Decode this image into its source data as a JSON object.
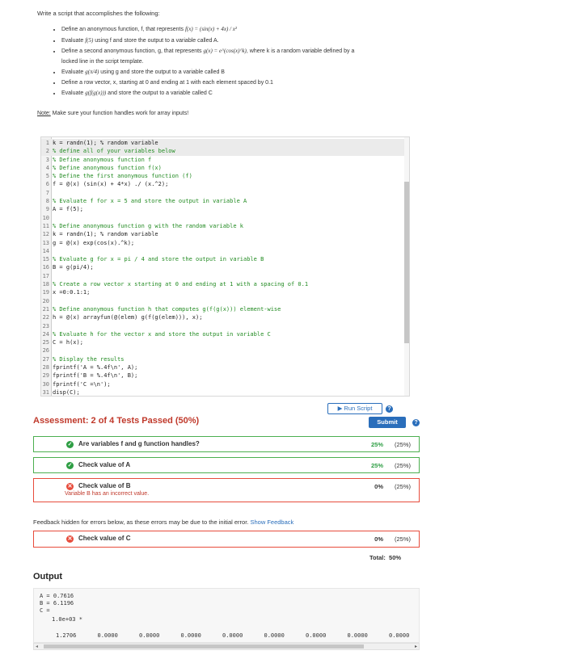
{
  "intro": "Write a script that accomplishes the following:",
  "tasks": [
    {
      "pre": "Define an anonymous function, f, that represents ",
      "math": "f(x) = (sin(x) + 4x) / x²",
      "post": ""
    },
    {
      "pre": "Evaluate ",
      "math": "f(5)",
      "post": " using f and store the output to a variable called A."
    },
    {
      "pre": "Define a second anonymous function, g, that represents ",
      "math": "g(x) = e^(cos(x)^k)",
      "post": ", where k is a random variable defined by a locked line in the script template."
    },
    {
      "pre": "Evaluate ",
      "math": "g(π/4)",
      "post": " using g and store the output to a variable called B"
    },
    {
      "pre": "Define a row vector, x, starting at 0 and ending at 1 with each element spaced by 0.1",
      "math": "",
      "post": ""
    },
    {
      "pre": "Evaluate ",
      "math": "g(f(g(x)))",
      "post": " and store the output to a variable called C"
    }
  ],
  "note_label": "Note:",
  "note_text": " Make sure your function handles work for array inputs!",
  "code": [
    {
      "n": "1",
      "t": "k = randn(1); % random variable",
      "c": false,
      "hl": true
    },
    {
      "n": "2",
      "t": "% define all of your variables below",
      "c": true,
      "hl": true
    },
    {
      "n": "3",
      "t": "% Define anonymous function f",
      "c": true,
      "hl": false
    },
    {
      "n": "4",
      "t": "% Define anonymous function f(x)",
      "c": true,
      "hl": false
    },
    {
      "n": "5",
      "t": "% Define the first anonymous function (f)",
      "c": true,
      "hl": false
    },
    {
      "n": "6",
      "t": "f = @(x) (sin(x) + 4*x) ./ (x.^2);",
      "c": false,
      "hl": false
    },
    {
      "n": "7",
      "t": "",
      "c": false,
      "hl": false
    },
    {
      "n": "8",
      "t": "% Evaluate f for x = 5 and store the output in variable A",
      "c": true,
      "hl": false
    },
    {
      "n": "9",
      "t": "A = f(5);",
      "c": false,
      "hl": false
    },
    {
      "n": "10",
      "t": "",
      "c": false,
      "hl": false
    },
    {
      "n": "11",
      "t": "% Define anonymous function g with the random variable k",
      "c": true,
      "hl": false
    },
    {
      "n": "12",
      "t": "k = randn(1); % random variable",
      "c": false,
      "hl": false
    },
    {
      "n": "13",
      "t": "g = @(x) exp(cos(x).^k);",
      "c": false,
      "hl": false
    },
    {
      "n": "14",
      "t": "",
      "c": false,
      "hl": false
    },
    {
      "n": "15",
      "t": "% Evaluate g for x = pi / 4 and store the output in variable B",
      "c": true,
      "hl": false
    },
    {
      "n": "16",
      "t": "B = g(pi/4);",
      "c": false,
      "hl": false
    },
    {
      "n": "17",
      "t": "",
      "c": false,
      "hl": false
    },
    {
      "n": "18",
      "t": "% Create a row vector x starting at 0 and ending at 1 with a spacing of 0.1",
      "c": true,
      "hl": false
    },
    {
      "n": "19",
      "t": "x =0:0.1:1;",
      "c": false,
      "hl": false
    },
    {
      "n": "20",
      "t": "",
      "c": false,
      "hl": false
    },
    {
      "n": "21",
      "t": "% Define anonymous function h that computes g(f(g(x))) element-wise",
      "c": true,
      "hl": false
    },
    {
      "n": "22",
      "t": "h = @(x) arrayfun(@(elem) g(f(g(elem))), x);",
      "c": false,
      "hl": false
    },
    {
      "n": "23",
      "t": "",
      "c": false,
      "hl": false
    },
    {
      "n": "24",
      "t": "% Evaluate h for the vector x and store the output in variable C",
      "c": true,
      "hl": false
    },
    {
      "n": "25",
      "t": "C = h(x);",
      "c": false,
      "hl": false
    },
    {
      "n": "26",
      "t": "",
      "c": false,
      "hl": false
    },
    {
      "n": "27",
      "t": "% Display the results",
      "c": true,
      "hl": false
    },
    {
      "n": "28",
      "t": "fprintf('A = %.4f\\n', A);",
      "c": false,
      "hl": false
    },
    {
      "n": "29",
      "t": "fprintf('B = %.4f\\n', B);",
      "c": false,
      "hl": false
    },
    {
      "n": "30",
      "t": "fprintf('C =\\n');",
      "c": false,
      "hl": false
    },
    {
      "n": "31",
      "t": "disp(C);",
      "c": false,
      "hl": false
    }
  ],
  "run_label": "▶ Run Script",
  "assessment_title": "Assessment: 2 of 4 Tests Passed (50%)",
  "submit_label": "Submit",
  "tests": [
    {
      "label": "Are variables f and g function handles?",
      "status": "pass",
      "pct": "25%",
      "of": "(25%)",
      "msg": ""
    },
    {
      "label": "Check value of A",
      "status": "pass",
      "pct": "25%",
      "of": "(25%)",
      "msg": ""
    },
    {
      "label": "Check value of B",
      "status": "fail",
      "pct": "0%",
      "of": "(25%)",
      "msg": "Variable B has an incorrect value."
    }
  ],
  "feedback_note": "Feedback hidden for errors below, as these errors may be due to the initial error.",
  "feedback_link": "Show Feedback",
  "test_c": {
    "label": "Check value of C",
    "status": "fail",
    "pct": "0%",
    "of": "(25%)"
  },
  "total_label": "Total:",
  "total_value": "50%",
  "output_title": "Output",
  "output_lines": [
    "A = 0.7616",
    "B = 6.1196",
    "C ="
  ],
  "output_scale": "1.0e+03 *",
  "output_values": [
    "1.2706",
    "0.0000",
    "0.0000",
    "0.0000",
    "0.0000",
    "0.0000",
    "0.0000",
    "0.0000",
    "0.0000"
  ],
  "icons": {
    "pass": "check-circle-icon",
    "fail": "x-circle-icon",
    "help": "question-icon"
  },
  "colors": {
    "accent": "#2a6ebb",
    "pass": "#2e9e44",
    "fail": "#e74c3c"
  }
}
